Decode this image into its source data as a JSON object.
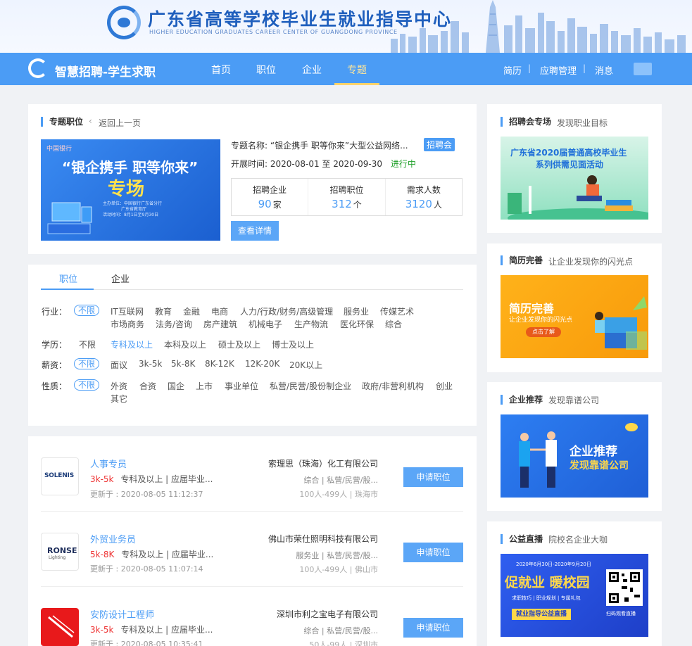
{
  "banner": {
    "title_cn": "广东省高等学校毕业生就业指导中心",
    "title_en": "HIGHER EDUCATION GRADUATES CAREER CENTER OF GUANGDONG PROVINCE"
  },
  "nav": {
    "brand": "智慧招聘-学生求职",
    "menu": [
      "首页",
      "职位",
      "企业",
      "专题"
    ],
    "active_menu": "专题",
    "right": [
      "简历",
      "应聘管理",
      "消息"
    ]
  },
  "topic": {
    "section_title": "专题职位",
    "back_link": "返回上一页",
    "image_bank": "中国银行",
    "image_title_1": "“银企携手 职等你来”",
    "image_title_2": "专场",
    "image_info_1": "主办单位：中国银行广东省分行",
    "image_info_2": "广东省教育厅",
    "image_info_3": "活动时间：8月1日至9月30日",
    "name_label": "专题名称:",
    "name_value": "“银企携手 职等你来”大型公益网络...",
    "tag": "招聘会",
    "date_label": "开展时间:",
    "date_value": "2020-08-01 至 2020-09-30",
    "status": "进行中",
    "stats": [
      {
        "label": "招聘企业",
        "value": "90",
        "unit": "家"
      },
      {
        "label": "招聘职位",
        "value": "312",
        "unit": "个"
      },
      {
        "label": "需求人数",
        "value": "3120",
        "unit": "人"
      }
    ],
    "detail_button": "查看详情"
  },
  "filters": {
    "tabs": [
      "职位",
      "企业"
    ],
    "industry_label": "行业：",
    "industry_options_row1": [
      "不限",
      "IT互联网",
      "教育",
      "金融",
      "电商",
      "人力/行政/财务/高级管理",
      "服务业",
      "传媒艺术"
    ],
    "industry_options_row2": [
      "市场商务",
      "法务/咨询",
      "房产建筑",
      "机械电子",
      "生产物流",
      "医化环保",
      "综合"
    ],
    "education_label": "学历：",
    "education_options": [
      "不限",
      "专科及以上",
      "本科及以上",
      "硕士及以上",
      "博士及以上"
    ],
    "salary_label": "薪资：",
    "salary_options": [
      "不限",
      "面议",
      "3k-5k",
      "5k-8K",
      "8K-12K",
      "12K-20K",
      "20K以上"
    ],
    "nature_label": "性质：",
    "nature_options_row1": [
      "不限",
      "外资",
      "合资",
      "国企",
      "上市",
      "事业单位",
      "私营/民营/股份制企业",
      "政府/非营利机构",
      "创业"
    ],
    "nature_options_row2": [
      "其它"
    ]
  },
  "jobs": [
    {
      "logo_text": "SOLENIS",
      "title": "人事专员",
      "salary": "3k-5k",
      "requirement": "专科及以上 | 应届毕业...",
      "updated": "更新于 : 2020-08-05 11:12:37",
      "company": "索理思（珠海）化工有限公司",
      "industry": "综合 | 私营/民营/股...",
      "size": "100人-499人 | 珠海市",
      "apply": "申请职位"
    },
    {
      "logo_text": "RONSE",
      "logo_sub": "Lighting",
      "title": "外贸业务员",
      "salary": "5k-8K",
      "requirement": "专科及以上 | 应届毕业...",
      "updated": "更新于 : 2020-08-05 11:07:14",
      "company": "佛山市荣仕照明科技有限公司",
      "industry": "服务业 | 私营/民营/股...",
      "size": "100人-499人 | 佛山市",
      "apply": "申请职位"
    },
    {
      "logo_text": "",
      "title": "安防设计工程师",
      "salary": "3k-5k",
      "requirement": "专科及以上 | 应届毕业...",
      "updated": "更新于 : 2020-08-05 10:35:41",
      "company": "深圳市利之宝电子有限公司",
      "industry": "综合 | 私营/民营/股...",
      "size": "50人-99人 | 深圳市",
      "apply": "申请职位"
    }
  ],
  "sidebar": [
    {
      "title": "招聘会专场",
      "subtitle": "发现职业目标",
      "image_text_1": "广东省2020届普通高校毕业生",
      "image_text_2": "系列供需见面活动"
    },
    {
      "title": "简历完善",
      "subtitle": "让企业发现你的闪光点",
      "image_text_1": "简历完善",
      "image_text_2": "让企业发现你的闪光点",
      "image_button": "点击了解"
    },
    {
      "title": "企业推荐",
      "subtitle": "发现靠谱公司",
      "image_text_1": "企业推荐",
      "image_text_2": "发现靠谱公司"
    },
    {
      "title": "公益直播",
      "subtitle": "院校名企业大咖",
      "image_text_0": "2020年6月30日-2020年9月20日",
      "image_text_1": "促就业 暖校园",
      "image_text_2": "求职技巧 | 职业规划 | 专属礼包",
      "image_text_3": "就业指导公益直播",
      "image_text_4": "扫码观看直播"
    }
  ],
  "colors": {
    "primary": "#4b9cf5",
    "salary": "#ee3333",
    "status": "#21a12b",
    "highlight": "#ffd36b"
  }
}
